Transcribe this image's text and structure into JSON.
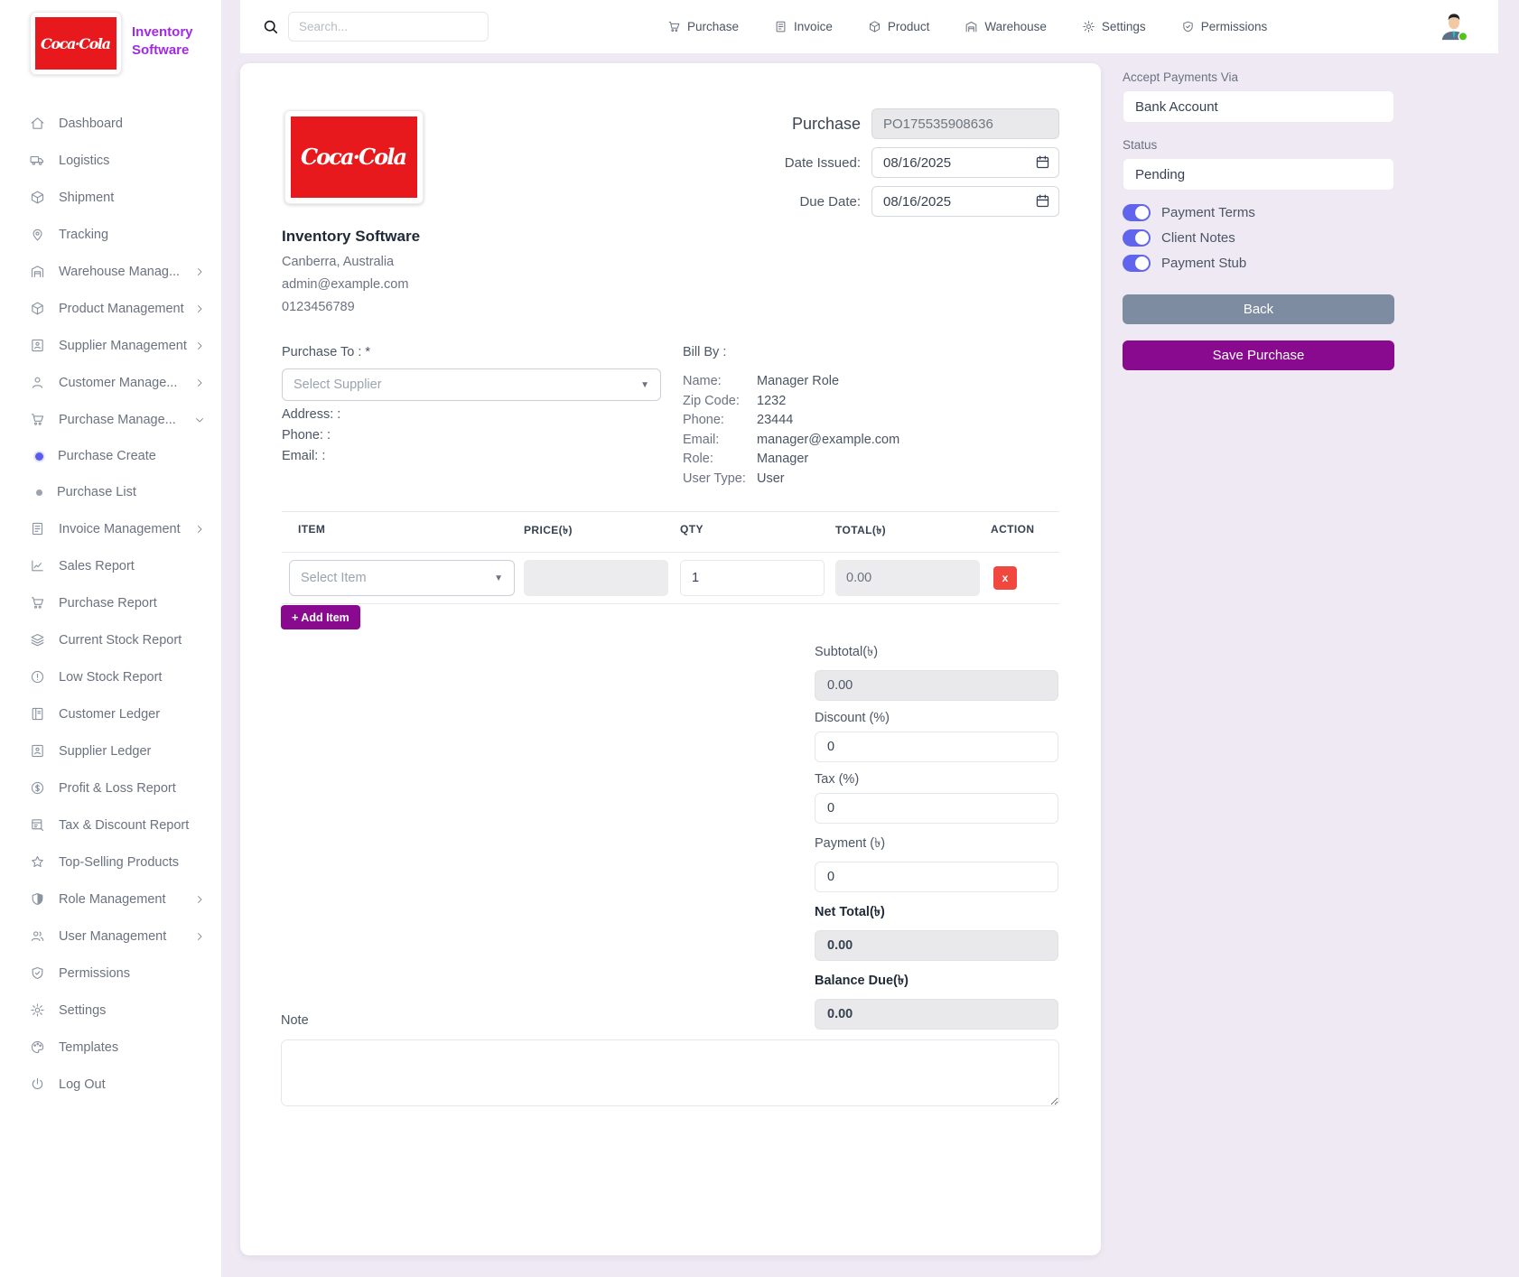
{
  "colors": {
    "accent_purple": "#8A0A8F",
    "brand_purple": "#A12BE0",
    "toggle_blue": "#6165EE",
    "back_gray": "#7D8CA1",
    "delete_red": "#F0483E",
    "coke_red": "#E8191C",
    "status_green": "#52C41A"
  },
  "brand": {
    "logo_text": "Coca·Cola",
    "app_name_line1": "Inventory",
    "app_name_line2": "Software"
  },
  "topbar": {
    "search_placeholder": "Search...",
    "nav": [
      {
        "label": "Purchase",
        "icon": "cart-icon"
      },
      {
        "label": "Invoice",
        "icon": "invoice-icon"
      },
      {
        "label": "Product",
        "icon": "box-icon"
      },
      {
        "label": "Warehouse",
        "icon": "warehouse-icon"
      },
      {
        "label": "Settings",
        "icon": "gear-icon"
      },
      {
        "label": "Permissions",
        "icon": "shield-icon"
      }
    ]
  },
  "sidebar": {
    "items": [
      {
        "label": "Dashboard",
        "icon": "home-icon"
      },
      {
        "label": "Logistics",
        "icon": "truck-icon"
      },
      {
        "label": "Shipment",
        "icon": "package-icon"
      },
      {
        "label": "Tracking",
        "icon": "location-icon"
      },
      {
        "label": "Warehouse Manag...",
        "icon": "warehouse-icon",
        "chevron": "right"
      },
      {
        "label": "Product Management",
        "icon": "box-icon",
        "chevron": "right"
      },
      {
        "label": "Supplier Management",
        "icon": "supplier-icon",
        "chevron": "right"
      },
      {
        "label": "Customer Manage...",
        "icon": "user-icon",
        "chevron": "right"
      },
      {
        "label": "Purchase Manage...",
        "icon": "cart-icon",
        "chevron": "down"
      },
      {
        "label": "Purchase Create",
        "type": "sub",
        "active": true
      },
      {
        "label": "Purchase List",
        "type": "sub"
      },
      {
        "label": "Invoice Management",
        "icon": "invoice-icon",
        "chevron": "right"
      },
      {
        "label": "Sales Report",
        "icon": "chart-icon"
      },
      {
        "label": "Purchase Report",
        "icon": "cart-icon"
      },
      {
        "label": "Current Stock Report",
        "icon": "layers-icon"
      },
      {
        "label": "Low Stock Report",
        "icon": "alert-icon"
      },
      {
        "label": "Customer Ledger",
        "icon": "ledger-icon"
      },
      {
        "label": "Supplier Ledger",
        "icon": "supplier-icon"
      },
      {
        "label": "Profit & Loss Report",
        "icon": "dollar-icon"
      },
      {
        "label": "Tax & Discount Report",
        "icon": "tax-icon"
      },
      {
        "label": "Top-Selling Products",
        "icon": "star-icon"
      },
      {
        "label": "Role Management",
        "icon": "role-icon",
        "chevron": "right"
      },
      {
        "label": "User Management",
        "icon": "users-icon",
        "chevron": "right"
      },
      {
        "label": "Permissions",
        "icon": "shield-icon"
      },
      {
        "label": "Settings",
        "icon": "gear-icon"
      },
      {
        "label": "Templates",
        "icon": "palette-icon"
      },
      {
        "label": "Log Out",
        "icon": "power-icon"
      }
    ]
  },
  "purchase_header": {
    "title": "Purchase",
    "po_number": "PO175535908636",
    "date_issued_label": "Date Issued:",
    "date_issued": "08/16/2025",
    "due_date_label": "Due Date:",
    "due_date": "08/16/2025"
  },
  "company": {
    "name": "Inventory Software",
    "location": "Canberra, Australia",
    "email": "admin@example.com",
    "phone": "0123456789"
  },
  "purchase_to": {
    "label": "Purchase To : *",
    "select_placeholder": "Select Supplier",
    "address_label": "Address: :",
    "phone_label": "Phone: :",
    "email_label": "Email: :"
  },
  "bill_by": {
    "title": "Bill By :",
    "rows": [
      {
        "label": "Name:",
        "value": "Manager Role"
      },
      {
        "label": "Zip Code:",
        "value": "1232"
      },
      {
        "label": "Phone:",
        "value": "23444"
      },
      {
        "label": "Email:",
        "value": "manager@example.com"
      },
      {
        "label": "Role:",
        "value": "Manager"
      },
      {
        "label": "User Type:",
        "value": "User"
      }
    ]
  },
  "items_table": {
    "headers": [
      "ITEM",
      "PRICE(৳)",
      "QTY",
      "TOTAL(৳)",
      "ACTION"
    ],
    "row": {
      "item_placeholder": "Select Item",
      "price": "",
      "qty": "1",
      "total": "0.00",
      "delete_label": "x"
    },
    "add_item_label": "+ Add Item"
  },
  "totals": [
    {
      "label": "Subtotal(৳)",
      "value": "0.00",
      "readonly": true
    },
    {
      "label": "Discount (%)",
      "value": "0"
    },
    {
      "label": "Tax (%)",
      "value": "0"
    },
    {
      "label": "Payment (৳)",
      "value": "0"
    },
    {
      "label": "Net Total(৳)",
      "value": "0.00",
      "readonly": true,
      "bold": true
    },
    {
      "label": "Balance Due(৳)",
      "value": "0.00",
      "readonly": true,
      "bold": true
    }
  ],
  "note": {
    "label": "Note",
    "value": ""
  },
  "side_panel": {
    "accept_payments_label": "Accept Payments Via",
    "accept_payments_value": "Bank Account",
    "status_label": "Status",
    "status_value": "Pending",
    "toggles": [
      {
        "label": "Payment Terms",
        "on": true
      },
      {
        "label": "Client Notes",
        "on": true
      },
      {
        "label": "Payment Stub",
        "on": true
      }
    ],
    "back_label": "Back",
    "save_label": "Save Purchase"
  }
}
